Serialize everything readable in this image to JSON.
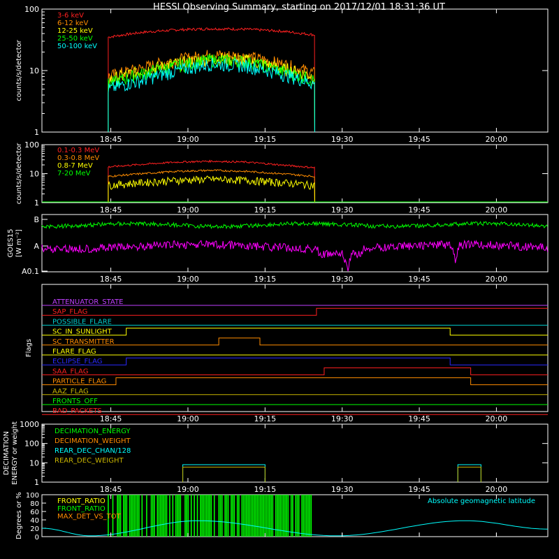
{
  "title": "HESSI Observing Summary, starting on 2017/12/01 18:31:36 UT",
  "time_ticks": [
    "18:45",
    "19:00",
    "19:15",
    "19:30",
    "19:45",
    "20:00"
  ],
  "colors": {
    "red": "#ff2020",
    "orange": "#ff8c00",
    "yellow": "#ffff00",
    "green": "#00ff00",
    "cyan": "#00ffff",
    "magenta": "#ff00ff",
    "blue": "#2a2aff",
    "olive": "#c8b400",
    "purple": "#c040ff"
  },
  "chart_data": [
    {
      "type": "line",
      "name": "low-energy-lightcurves",
      "ylabel": "counts/s/detector",
      "yscale": "log",
      "ylim": [
        1,
        100
      ],
      "yticks": [
        "1",
        "10",
        "100"
      ],
      "series": [
        {
          "name": "3-6 keV",
          "color": "#ff2020",
          "start": "18:44:30",
          "end": "19:24:40",
          "levels": [
            35,
            42,
            46,
            48,
            47,
            44,
            38
          ]
        },
        {
          "name": "6-12 keV",
          "color": "#ff8c00",
          "start": "18:44:30",
          "end": "19:24:40",
          "levels": [
            8,
            11,
            15,
            18,
            17,
            13,
            9
          ]
        },
        {
          "name": "12-25 keV",
          "color": "#ffff00",
          "start": "18:44:30",
          "end": "19:24:40",
          "levels": [
            7,
            10,
            13,
            16,
            15,
            11,
            8
          ]
        },
        {
          "name": "25-50 keV",
          "color": "#00ff00",
          "start": "18:44:30",
          "end": "19:24:40",
          "levels": [
            6,
            9,
            12,
            15,
            14,
            10,
            7
          ]
        },
        {
          "name": "50-100 keV",
          "color": "#00ffff",
          "start": "18:44:30",
          "end": "19:24:40",
          "levels": [
            5,
            7,
            10,
            13,
            12,
            9,
            6
          ]
        }
      ]
    },
    {
      "type": "line",
      "name": "high-energy-lightcurves",
      "ylabel": "counts/s/detector",
      "yscale": "log",
      "ylim": [
        1,
        100
      ],
      "yticks": [
        "1",
        "10",
        "100"
      ],
      "series": [
        {
          "name": "0.1-0.3 MeV",
          "color": "#ff2020",
          "start": "18:44:30",
          "end": "19:24:40",
          "levels": [
            17,
            21,
            25,
            27,
            25,
            20,
            16
          ]
        },
        {
          "name": "0.3-0.8 MeV",
          "color": "#ff8c00",
          "start": "18:44:30",
          "end": "19:24:40",
          "levels": [
            8,
            10,
            12,
            13,
            12,
            10,
            8
          ]
        },
        {
          "name": "0.8-7 MeV",
          "color": "#ffff00",
          "start": "18:44:30",
          "end": "19:24:40",
          "levels": [
            4,
            5,
            6,
            6.5,
            6,
            5,
            4
          ]
        },
        {
          "name": "7-20 MeV",
          "color": "#00ff00",
          "start": "18:31:36",
          "end": "20:10:00",
          "levels": [
            1,
            1,
            1
          ]
        }
      ]
    },
    {
      "type": "line",
      "name": "goes-panel",
      "ylabel": "GOES15",
      "yunit": "[W m⁻²]",
      "yticks": [
        "A0.1",
        "A",
        "B"
      ],
      "series": [
        {
          "name": "GOES high channel",
          "color": "#00ff00",
          "level": "B",
          "levels": [
            0.8,
            0.85,
            0.9
          ]
        },
        {
          "name": "GOES low channel",
          "color": "#ff00ff",
          "level": "A",
          "levels": [
            0.2,
            0.1,
            0.2
          ],
          "dips_at": [
            "19:31",
            "19:52"
          ]
        }
      ]
    },
    {
      "type": "line",
      "name": "flags-panel",
      "ylabel": "Flags",
      "rows": [
        {
          "name": "ATTENUATOR_STATE",
          "color": "#c040ff",
          "steps": []
        },
        {
          "name": "SAP_FLAG",
          "color": "#ff2020",
          "steps": [
            "19:25:00"
          ]
        },
        {
          "name": "POSSIBLE_FLARE",
          "color": "#00cccc",
          "steps": []
        },
        {
          "name": "SC_IN_SUNLIGHT",
          "color": "#ffff00",
          "steps": [
            "18:48:00",
            "19:51:00"
          ]
        },
        {
          "name": "SC_TRANSMITTER",
          "color": "#ff8c00",
          "steps": [
            "19:06:00",
            "19:14:00"
          ]
        },
        {
          "name": "FLARE_FLAG",
          "color": "#ffff00",
          "steps": []
        },
        {
          "name": "ECLIPSE_FLAG",
          "color": "#2a2aff",
          "steps": [
            "18:48:00",
            "19:51:00"
          ]
        },
        {
          "name": "SAA_FLAG",
          "color": "#ff2020",
          "steps": [
            "19:26:30",
            "19:55:00"
          ]
        },
        {
          "name": "PARTICLE_FLAG",
          "color": "#ff8c00",
          "steps": [
            "18:46:00",
            "19:55:00"
          ]
        },
        {
          "name": "AAZ_FLAG",
          "color": "#c8b400",
          "steps": []
        },
        {
          "name": "FRONTS_OFF",
          "color": "#00ff00",
          "steps": []
        },
        {
          "name": "BAD_PACKETS",
          "color": "#ff2020",
          "steps": []
        }
      ]
    },
    {
      "type": "line",
      "name": "decimation-panel",
      "ylabel": "DECIMATION ENERGY or weight",
      "yscale": "log",
      "ylim": [
        1,
        1000
      ],
      "yticks": [
        "1",
        "10",
        "100",
        "1000"
      ],
      "series": [
        {
          "name": "DECIMATION_ENERGY",
          "color": "#00ff00"
        },
        {
          "name": "DECIMATION_WEIGHT",
          "color": "#ff8c00"
        },
        {
          "name": "REAR_DEC_CHAN/128",
          "color": "#00ffff",
          "windows": [
            [
              "18:59:00",
              "19:15:00"
            ],
            [
              "19:52:30",
              "19:57:00"
            ]
          ],
          "value": 8
        },
        {
          "name": "REAR_DEC_WEIGHT",
          "color": "#c8b400",
          "windows": [
            [
              "18:59:00",
              "19:15:00"
            ],
            [
              "19:52:30",
              "19:57:00"
            ]
          ],
          "value": 6
        }
      ]
    },
    {
      "type": "line",
      "name": "ratio-panel",
      "ylabel": "Degrees or %",
      "ylim": [
        0,
        100
      ],
      "yticks": [
        "0",
        "20",
        "40",
        "60",
        "80",
        "100"
      ],
      "annotation": "Absolute geomagnetic latitude",
      "series": [
        {
          "name": "FRONT_RATIO",
          "color": "#ffff00"
        },
        {
          "name": "FRONT_RATIO",
          "color": "#00ff00",
          "start": "18:44:30",
          "end": "19:24:40"
        },
        {
          "name": "MAX_DET_VS_TOT",
          "color": "#ff8c00"
        },
        {
          "name": "Absolute geomagnetic latitude",
          "color": "#00ffff",
          "points": [
            [
              "18:31:36",
              20
            ],
            [
              "18:41:00",
              2
            ],
            [
              "19:02:00",
              38
            ],
            [
              "19:29:00",
              2
            ],
            [
              "19:54:00",
              38
            ],
            [
              "20:10:00",
              18
            ]
          ]
        }
      ]
    }
  ]
}
